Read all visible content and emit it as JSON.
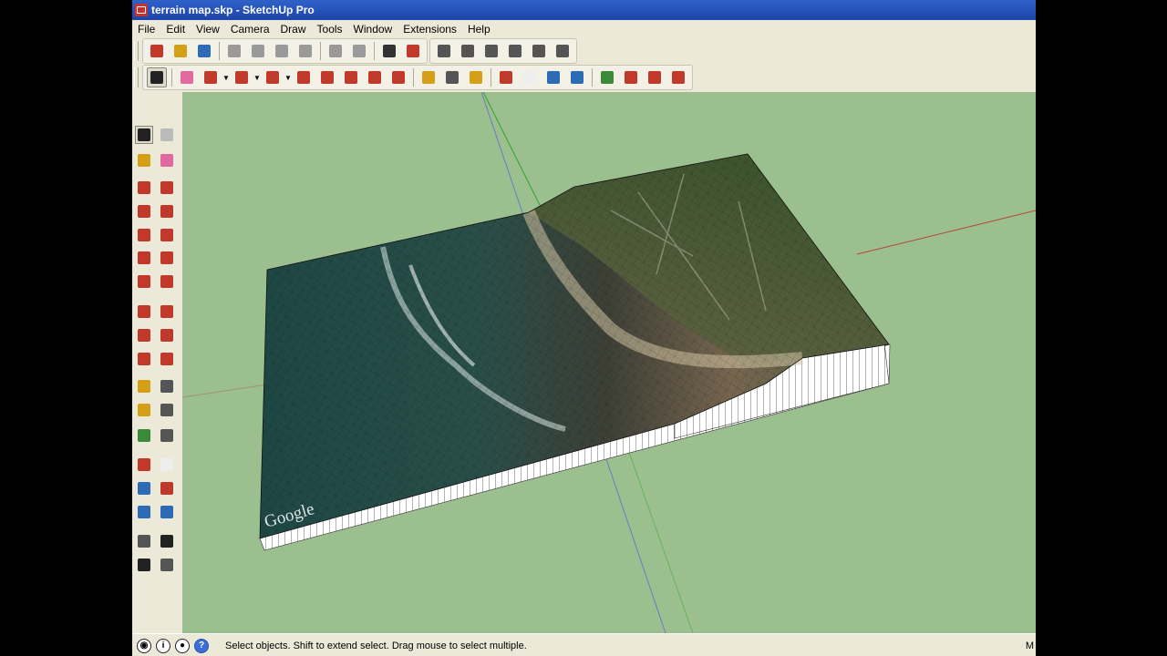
{
  "window": {
    "title": "terrain map.skp - SketchUp Pro"
  },
  "menu": [
    "File",
    "Edit",
    "View",
    "Camera",
    "Draw",
    "Tools",
    "Window",
    "Extensions",
    "Help"
  ],
  "toolbar_standard": [
    {
      "name": "new-icon",
      "color": "#c0392b"
    },
    {
      "name": "open-icon",
      "color": "#d4a017"
    },
    {
      "name": "save-icon",
      "color": "#2d6bb5"
    },
    {
      "name": "cut-icon",
      "color": "#9a9a9a"
    },
    {
      "name": "copy-icon",
      "color": "#9a9a9a"
    },
    {
      "name": "paste-icon",
      "color": "#9a9a9a"
    },
    {
      "name": "erase-icon",
      "color": "#9a9a9a"
    },
    {
      "name": "undo-icon",
      "color": "#9a9a9a"
    },
    {
      "name": "redo-icon",
      "color": "#9a9a9a"
    },
    {
      "name": "print-icon",
      "color": "#333333"
    },
    {
      "name": "model-info-icon",
      "color": "#c0392b"
    },
    {
      "name": "iso-view-icon",
      "color": "#555555"
    },
    {
      "name": "top-view-icon",
      "color": "#555555"
    },
    {
      "name": "front-view-icon",
      "color": "#555555"
    },
    {
      "name": "right-view-icon",
      "color": "#555555"
    },
    {
      "name": "back-view-icon",
      "color": "#555555"
    },
    {
      "name": "left-view-icon",
      "color": "#555555"
    }
  ],
  "toolbar_tools": [
    {
      "name": "select-icon",
      "color": "#222222",
      "selected": true
    },
    {
      "name": "eraser-icon",
      "color": "#e06aa0"
    },
    {
      "name": "pencil-icon",
      "color": "#c0392b"
    },
    {
      "name": "arc-icon",
      "color": "#c0392b"
    },
    {
      "name": "rectangle-icon",
      "color": "#c0392b"
    },
    {
      "name": "push-pull-icon",
      "color": "#c0392b"
    },
    {
      "name": "follow-me-icon",
      "color": "#c0392b"
    },
    {
      "name": "move-icon",
      "color": "#c0392b"
    },
    {
      "name": "rotate-icon",
      "color": "#c0392b"
    },
    {
      "name": "scale-icon",
      "color": "#c0392b"
    },
    {
      "name": "tape-measure-icon",
      "color": "#d4a017"
    },
    {
      "name": "text-icon",
      "color": "#555555"
    },
    {
      "name": "paint-bucket-icon",
      "color": "#d4a017"
    },
    {
      "name": "orbit-icon",
      "color": "#c0392b"
    },
    {
      "name": "pan-icon",
      "color": "#eeeeee"
    },
    {
      "name": "zoom-icon",
      "color": "#2d6bb5"
    },
    {
      "name": "zoom-extents-icon",
      "color": "#2d6bb5"
    },
    {
      "name": "add-location-icon",
      "color": "#3a8a3a"
    },
    {
      "name": "toggle-terrain-icon",
      "color": "#c0392b"
    },
    {
      "name": "photo-textures-icon",
      "color": "#c0392b"
    },
    {
      "name": "share-model-icon",
      "color": "#c0392b"
    }
  ],
  "toolbar_left": [
    {
      "name": "select-icon",
      "color": "#222222",
      "selected": true
    },
    {
      "name": "make-component-icon",
      "color": "#bbbbbb"
    },
    {
      "name": "paint-bucket-icon",
      "color": "#d4a017"
    },
    {
      "name": "eraser-icon",
      "color": "#e06aa0"
    },
    {
      "name": "line-icon",
      "color": "#c0392b"
    },
    {
      "name": "freehand-icon",
      "color": "#c0392b"
    },
    {
      "name": "rectangle-icon",
      "color": "#c0392b"
    },
    {
      "name": "rotated-rectangle-icon",
      "color": "#c0392b"
    },
    {
      "name": "circle-icon",
      "color": "#c0392b"
    },
    {
      "name": "polygon-icon",
      "color": "#c0392b"
    },
    {
      "name": "arc-icon",
      "color": "#c0392b"
    },
    {
      "name": "two-point-arc-icon",
      "color": "#c0392b"
    },
    {
      "name": "three-point-arc-icon",
      "color": "#c0392b"
    },
    {
      "name": "pie-icon",
      "color": "#c0392b"
    },
    {
      "name": "move-icon",
      "color": "#c0392b"
    },
    {
      "name": "push-pull-icon",
      "color": "#c0392b"
    },
    {
      "name": "rotate-icon",
      "color": "#c0392b"
    },
    {
      "name": "follow-me-icon",
      "color": "#c0392b"
    },
    {
      "name": "scale-icon",
      "color": "#c0392b"
    },
    {
      "name": "offset-icon",
      "color": "#c0392b"
    },
    {
      "name": "tape-measure-icon",
      "color": "#d4a017"
    },
    {
      "name": "dimension-icon",
      "color": "#555555"
    },
    {
      "name": "protractor-icon",
      "color": "#d4a017"
    },
    {
      "name": "text-icon",
      "color": "#555555"
    },
    {
      "name": "axes-icon",
      "color": "#3a8a3a"
    },
    {
      "name": "3d-text-icon",
      "color": "#555555"
    },
    {
      "name": "orbit-icon",
      "color": "#c0392b"
    },
    {
      "name": "pan-icon",
      "color": "#eeeeee"
    },
    {
      "name": "zoom-icon",
      "color": "#2d6bb5"
    },
    {
      "name": "zoom-window-icon",
      "color": "#c0392b"
    },
    {
      "name": "zoom-extents-icon",
      "color": "#2d6bb5"
    },
    {
      "name": "previous-view-icon",
      "color": "#2d6bb5"
    },
    {
      "name": "position-camera-icon",
      "color": "#555555"
    },
    {
      "name": "look-around-icon",
      "color": "#222222"
    },
    {
      "name": "walk-icon",
      "color": "#222222"
    },
    {
      "name": "section-plane-icon",
      "color": "#555555"
    }
  ],
  "viewport": {
    "background": "#9bbf8e",
    "watermark": "Google"
  },
  "status": {
    "text": "Select objects. Shift to extend select. Drag mouse to select multiple.",
    "measurements_label": "M",
    "icons": [
      {
        "name": "geo-location-icon",
        "glyph": "◉"
      },
      {
        "name": "credits-icon",
        "glyph": "i"
      },
      {
        "name": "user-account-icon",
        "glyph": "●"
      },
      {
        "name": "instructor-help-icon",
        "glyph": "?"
      }
    ]
  }
}
